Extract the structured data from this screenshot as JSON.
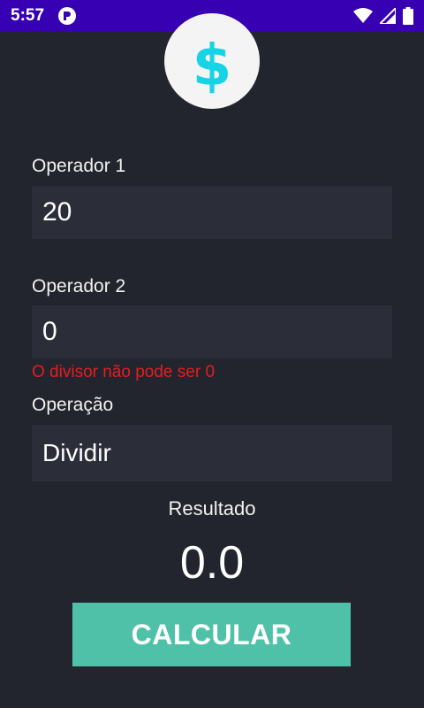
{
  "status_bar": {
    "time": "5:57",
    "background_color": "#3700b3",
    "icons": [
      "app-notification-icon",
      "wifi-icon",
      "signal-icon",
      "battery-icon"
    ]
  },
  "logo": {
    "symbol": "$",
    "symbol_color": "#16d4e6",
    "background_color": "#f4f4f4"
  },
  "form": {
    "operator1": {
      "label": "Operador 1",
      "value": "20"
    },
    "operator2": {
      "label": "Operador 2",
      "value": "0",
      "error": "O divisor não pode ser 0"
    },
    "operation": {
      "label": "Operação",
      "selected": "Dividir"
    }
  },
  "result": {
    "label": "Resultado",
    "value": "0.0"
  },
  "calculate_button": {
    "label": "CALCULAR",
    "color": "#4fc1a8"
  },
  "colors": {
    "background": "#22252d",
    "field_background": "#2b2e39",
    "error": "#e41e1e"
  }
}
